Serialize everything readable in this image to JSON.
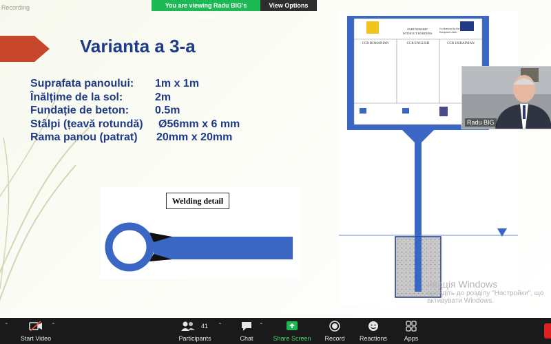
{
  "recording_label": "Recording",
  "share_banner": {
    "text": "You are viewing Radu BIG's screen",
    "view_options": "View Options"
  },
  "slide": {
    "title": "Varianta a 3-a",
    "specs": [
      {
        "label": "Suprafata panoului:",
        "value": "1m x 1m"
      },
      {
        "label": "Înălțime de la sol:",
        "value": "2m"
      },
      {
        "label": "Fundație de beton:",
        "value": "0.5m"
      },
      {
        "label": "Stâlpi (țeavă rotundă)",
        "value": "Ø56mm x 6 mm"
      },
      {
        "label": "Rama panou (patrat)",
        "value": "20mm x 20mm"
      }
    ],
    "welding_title": "Welding detail",
    "panel": {
      "header_title_1": "PARTNERSHIP",
      "header_title_2": "WITHOUT BORDERS",
      "cofunded": "Co-financed by the European Union",
      "columns": [
        "CCR ROMANIAN",
        "CCR ENGLISH",
        "CCR UKRAINIAN"
      ]
    },
    "colors": {
      "title": "#1f3a86",
      "structure": "#3a67c4",
      "arrow": "#c6452b"
    }
  },
  "video": {
    "name": "Radu BIG"
  },
  "activation": {
    "title": "ивація Windows",
    "line1": "ерейдіть до розділу \"Настройки\", що",
    "line2": "активувати Windows."
  },
  "toolbar": {
    "start_video": "Start Video",
    "participants": "Participants",
    "participants_count": "41",
    "chat": "Chat",
    "share_screen": "Share Screen",
    "record": "Record",
    "reactions": "Reactions",
    "apps": "Apps"
  }
}
